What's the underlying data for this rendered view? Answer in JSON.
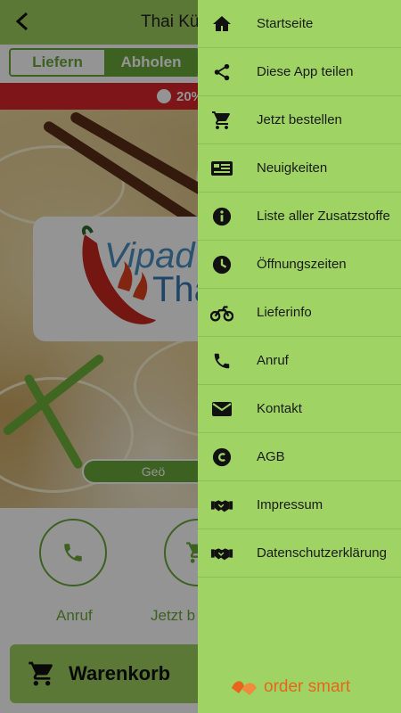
{
  "header": {
    "title": "Thai Küc"
  },
  "mode_tabs": [
    {
      "label": "Liefern",
      "active": false
    },
    {
      "label": "Abholen",
      "active": true
    }
  ],
  "promo": {
    "text": "20%"
  },
  "logo": {
    "line1": "Vipad",
    "line2": "Tha"
  },
  "status_pill": {
    "text": "Geö"
  },
  "actions": [
    {
      "label": "Anruf",
      "icon": "phone-icon"
    },
    {
      "label": "Jetzt b",
      "icon": "cart-icon"
    }
  ],
  "cart_button": {
    "label": "Warenkorb",
    "icon": "cart-icon"
  },
  "drawer": {
    "items": [
      {
        "label": "Startseite",
        "icon": "home-icon"
      },
      {
        "label": "Diese App teilen",
        "icon": "share-icon"
      },
      {
        "label": "Jetzt bestellen",
        "icon": "cart-icon"
      },
      {
        "label": "Neuigkeiten",
        "icon": "news-icon"
      },
      {
        "label": "Liste aller Zusatzstoffe",
        "icon": "info-icon"
      },
      {
        "label": "Öffnungszeiten",
        "icon": "clock-icon"
      },
      {
        "label": "Lieferinfo",
        "icon": "motorcycle-icon"
      },
      {
        "label": "Anruf",
        "icon": "phone-icon"
      },
      {
        "label": "Kontakt",
        "icon": "mail-icon"
      },
      {
        "label": "AGB",
        "icon": "copyright-icon"
      },
      {
        "label": "Impressum",
        "icon": "handshake-icon"
      },
      {
        "label": "Datenschutzerklärung",
        "icon": "handshake-icon"
      }
    ],
    "brand": "order smart"
  },
  "colors": {
    "accent_green": "#6aa83a",
    "drawer_green": "#9fd464",
    "promo_red": "#d9252a",
    "brand_orange": "#e9641c"
  }
}
